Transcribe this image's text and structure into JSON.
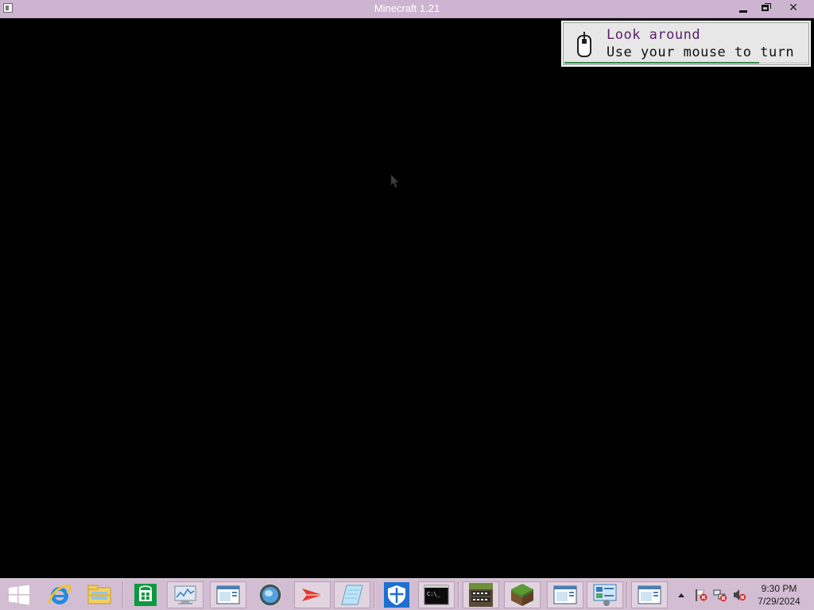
{
  "window": {
    "title": "Minecraft 1.21",
    "minimize_label": "minimize",
    "restore_label": "restore",
    "close_label": "close"
  },
  "toast": {
    "title": "Look around",
    "message": "Use your mouse to turn",
    "progress": 0.8
  },
  "taskbar": {
    "items": [
      "start-button",
      "internet-explorer",
      "file-explorer",
      "store",
      "performance-monitor",
      "window-app-1",
      "network-globe",
      "acrobat-reader",
      "notepad",
      "windows-defender",
      "command-prompt",
      "betacraft",
      "minecraft",
      "window-app-2",
      "control-panel",
      "window-app-3"
    ]
  },
  "clock": {
    "time": "9:30 PM",
    "date": "7/29/2024"
  },
  "colors": {
    "titlebar": "#cdb4d0",
    "taskbar": "#d3bdd2",
    "toast_title": "#5b1d6a",
    "progress": "#3a8a4d"
  }
}
